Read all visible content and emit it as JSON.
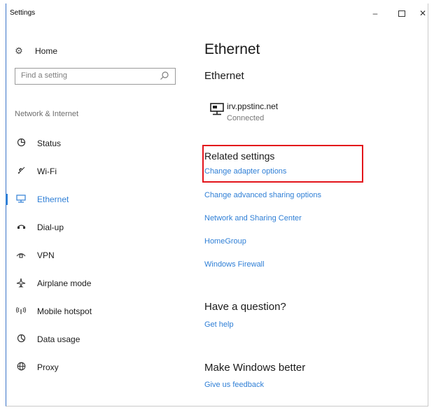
{
  "window": {
    "title": "Settings",
    "controls": {
      "minimize": "–",
      "close": "✕"
    }
  },
  "sidebar": {
    "home_label": "Home",
    "search_placeholder": "Find a setting",
    "section_label": "Network & Internet",
    "items": [
      {
        "label": "Status",
        "icon": "status-icon"
      },
      {
        "label": "Wi-Fi",
        "icon": "wifi-icon"
      },
      {
        "label": "Ethernet",
        "icon": "ethernet-icon",
        "active": true
      },
      {
        "label": "Dial-up",
        "icon": "dialup-icon"
      },
      {
        "label": "VPN",
        "icon": "vpn-icon"
      },
      {
        "label": "Airplane mode",
        "icon": "airplane-icon"
      },
      {
        "label": "Mobile hotspot",
        "icon": "hotspot-icon"
      },
      {
        "label": "Data usage",
        "icon": "data-usage-icon"
      },
      {
        "label": "Proxy",
        "icon": "proxy-icon"
      }
    ]
  },
  "main": {
    "page_title": "Ethernet",
    "section_title": "Ethernet",
    "network": {
      "name": "irv.ppstinc.net",
      "status": "Connected"
    },
    "related": {
      "title": "Related settings",
      "links": [
        "Change adapter options",
        "Change advanced sharing options",
        "Network and Sharing Center",
        "HomeGroup",
        "Windows Firewall"
      ]
    },
    "question": {
      "title": "Have a question?",
      "link": "Get help"
    },
    "feedback": {
      "title": "Make Windows better",
      "link": "Give us feedback"
    }
  },
  "colors": {
    "accent": "#2f7fd6",
    "highlight": "#e3141b"
  }
}
